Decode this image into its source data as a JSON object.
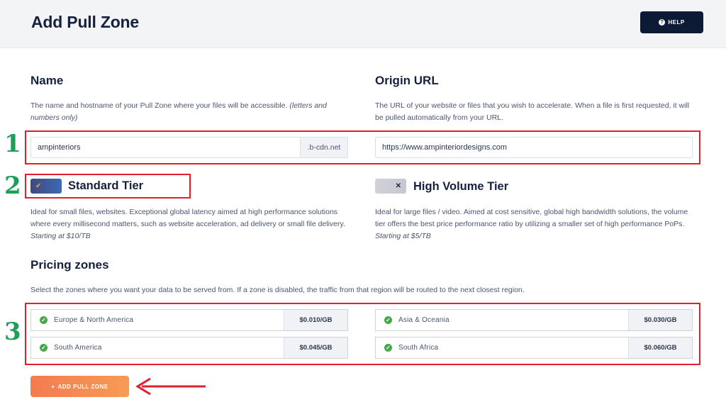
{
  "header": {
    "title": "Add Pull Zone",
    "help_label": "HELP",
    "help_icon": "question-circle-icon"
  },
  "name_section": {
    "heading": "Name",
    "description": "The name and hostname of your Pull Zone where your files will be accessible.",
    "description_note": "(letters and numbers only)",
    "input_value": "ampinteriors",
    "suffix": ".b-cdn.net"
  },
  "origin_section": {
    "heading": "Origin URL",
    "description": "The URL of your website or files that you wish to accelerate. When a file is first requested, it will be pulled automatically from your URL.",
    "input_value": "https://www.ampinteriordesigns.com"
  },
  "tiers": {
    "standard": {
      "label": "Standard Tier",
      "enabled": true,
      "description": "Ideal for small files, websites. Exceptional global latency aimed at high performance solutions where every millisecond matters, such as website acceleration, ad delivery or small file delivery.",
      "price_note": "Starting at $10/TB"
    },
    "high_volume": {
      "label": "High Volume Tier",
      "enabled": false,
      "description": "Ideal for large files / video. Aimed at cost sensitive, global high bandwidth solutions, the volume tier offers the best price performance ratio by utilizing a smaller set of high performance PoPs.",
      "price_note": "Starting at $5/TB"
    }
  },
  "pricing": {
    "heading": "Pricing zones",
    "description": "Select the zones where you want your data to be served from. If a zone is disabled, the traffic from that region will be routed to the next closest region.",
    "zones": [
      {
        "name": "Europe & North America",
        "price": "$0.010/GB",
        "enabled": true
      },
      {
        "name": "Asia & Oceania",
        "price": "$0.030/GB",
        "enabled": true
      },
      {
        "name": "South America",
        "price": "$0.045/GB",
        "enabled": true
      },
      {
        "name": "South Africa",
        "price": "$0.060/GB",
        "enabled": true
      }
    ]
  },
  "actions": {
    "add_label": "ADD PULL ZONE",
    "add_icon": "plus-icon"
  },
  "annotations": {
    "one": "1",
    "two": "2",
    "three": "3"
  },
  "colors": {
    "accent_red": "#e0202e",
    "annotation_green": "#1e9e5a",
    "primary_navy": "#0c1a36",
    "button_orange": "#f47b50",
    "check_green": "#47a84a"
  }
}
